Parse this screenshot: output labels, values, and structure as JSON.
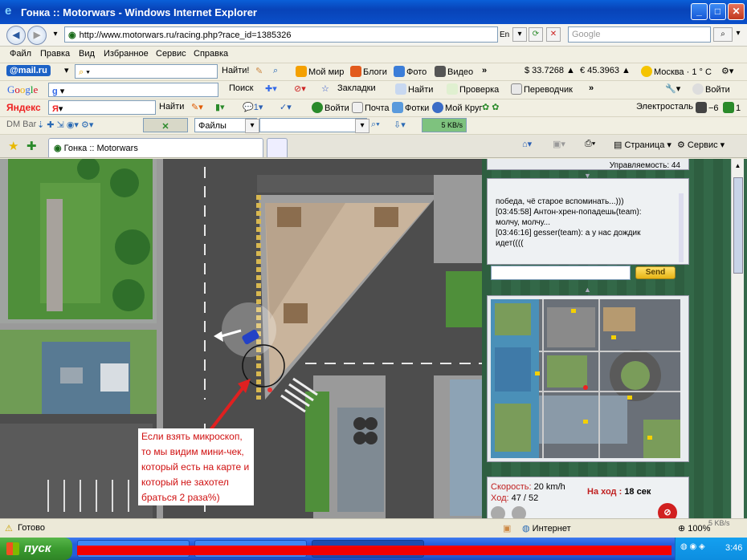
{
  "window": {
    "title": "Гонка :: Motorwars - Windows Internet Explorer"
  },
  "nav": {
    "url": "http://www.motorwars.ru/racing.php?race_id=1385326",
    "lang_indicator": "En",
    "search_placeholder": "Google"
  },
  "menu": [
    "Файл",
    "Правка",
    "Вид",
    "Избранное",
    "Сервис",
    "Справка"
  ],
  "mailru_bar": {
    "logo": "@mail.ru",
    "find_label": "Найти!",
    "items": [
      "Мой мир",
      "Блоги",
      "Фото",
      "Видео"
    ],
    "usd": "$ 33.7268 ▲",
    "eur": "€ 45.3963 ▲",
    "weather": "Москва · 1 ° С"
  },
  "google_bar": {
    "logo": "Google",
    "search_label": "Поиск",
    "bookmarks_label": "Закладки",
    "find_label": "Найти",
    "spell_label": "Проверка",
    "translate_label": "Переводчик",
    "signin_label": "Войти"
  },
  "yandex_bar": {
    "logo": "Яндекс",
    "find_label": "Найти",
    "signin_label": "Войти",
    "mail_label": "Почта",
    "photos_label": "Фотки",
    "circle_label": "Мой Круг",
    "energy_label": "Электросталь",
    "temp1": "−6",
    "temp2": "1"
  },
  "dm_bar": {
    "label": "DM Bar",
    "files_label": "Файлы",
    "speed": "5 KB/s"
  },
  "tab_row": {
    "tab_title": "Гонка :: Motorwars",
    "page_label": "Страница",
    "tools_label": "Сервис"
  },
  "game": {
    "handling_text": "Управляемость: 44",
    "annotation_lines": [
      "Если взять микроскоп,",
      "то мы видим мини-чек,",
      "который есть на карте и",
      "который не захотел",
      "браться 2 раза%)"
    ],
    "chat": [
      "победа, чё старое вспоминать...)))",
      "[03:45:58] Антон-хрен-попадешь(team):",
      "молчу, молчу...",
      "[03:46:16] gesser(team): а у нас дождик",
      "идет((((",
      ""
    ],
    "send_label": "Send",
    "speed_label": "Скорость:",
    "speed_value": "20 km/h",
    "move_label": "Ход:",
    "move_value": "47 / 52",
    "turn_label": "На ход :",
    "turn_value": "18 сек"
  },
  "status": {
    "text": "Готово",
    "zone": "Интернет",
    "zoom": "100%",
    "speed": "5 KB/s"
  },
  "taskbar": {
    "start_label": "пуск",
    "time": "3:46"
  }
}
